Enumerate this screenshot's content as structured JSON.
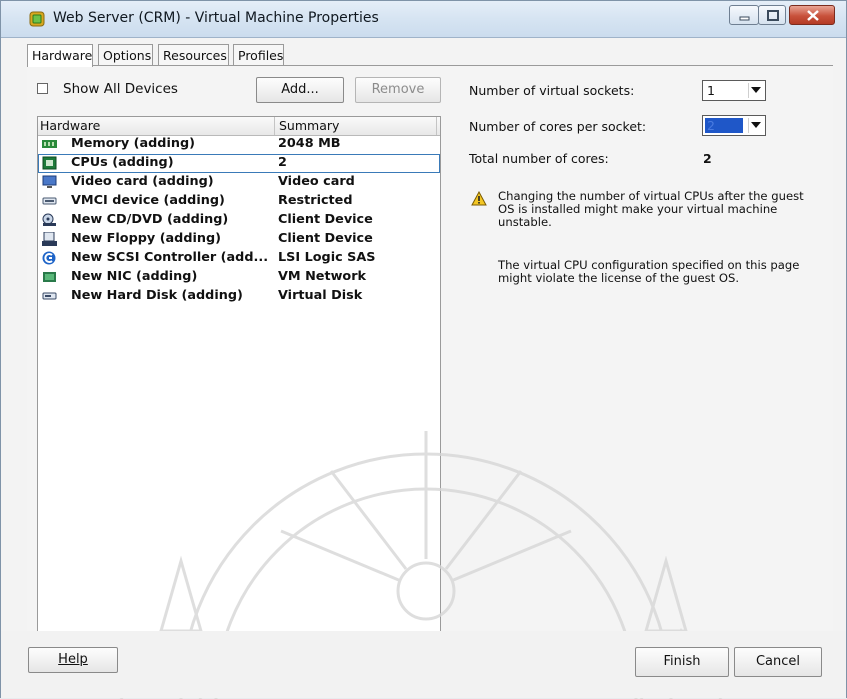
{
  "window": {
    "title": "Web Server (CRM) - Virtual Machine Properties",
    "title_icon": "vm-icon"
  },
  "tabs": [
    {
      "label": "Hardware",
      "active": true
    },
    {
      "label": "Options",
      "active": false
    },
    {
      "label": "Resources",
      "active": false
    },
    {
      "label": "Profiles",
      "active": false
    }
  ],
  "toolbar": {
    "show_all_devices": "Show All Devices",
    "show_all_checked": false,
    "add_label": "Add...",
    "remove_label": "Remove"
  },
  "hardware_list": {
    "columns": [
      "Hardware",
      "Summary"
    ],
    "rows": [
      {
        "name": "Memory (adding)",
        "summary": "2048 MB",
        "icon": "memory-icon",
        "selected": false
      },
      {
        "name": "CPUs (adding)",
        "summary": "2",
        "icon": "cpu-icon",
        "selected": true
      },
      {
        "name": "Video card  (adding)",
        "summary": "Video card",
        "icon": "monitor-icon",
        "selected": false
      },
      {
        "name": "VMCI device (adding)",
        "summary": "Restricted",
        "icon": "vmci-icon",
        "selected": false
      },
      {
        "name": "New CD/DVD (adding)",
        "summary": "Client Device",
        "icon": "cd-dvd-icon",
        "selected": false
      },
      {
        "name": "New Floppy (adding)",
        "summary": "Client Device",
        "icon": "floppy-icon",
        "selected": false
      },
      {
        "name": "New SCSI Controller (add...",
        "summary": "LSI Logic SAS",
        "icon": "scsi-icon",
        "selected": false
      },
      {
        "name": "New NIC (adding)",
        "summary": "VM Network",
        "icon": "nic-icon",
        "selected": false
      },
      {
        "name": "New Hard Disk (adding)",
        "summary": "Virtual Disk",
        "icon": "hard-disk-icon",
        "selected": false
      }
    ]
  },
  "cpu_settings": {
    "sockets_label": "Number of virtual sockets:",
    "sockets_value": "1",
    "cores_label": "Number of cores per socket:",
    "cores_value": "2",
    "total_label": "Total number of cores:",
    "total_value": "2",
    "warning_line1": "Changing the number of virtual CPUs after the guest",
    "warning_line2": "OS is installed might make your virtual machine",
    "warning_line3": "unstable.",
    "license_line1": "The virtual CPU configuration specified on this page",
    "license_line2": "might violate the license of the guest OS."
  },
  "footer": {
    "help_label": "Help",
    "finish_label": "Finish",
    "cancel_label": "Cancel"
  },
  "colors": {
    "titlebar": "#d6e4f2",
    "selection_outline": "#3a7ab8",
    "close_button": "#c8523c",
    "combo_selection": "#1f57c8"
  }
}
